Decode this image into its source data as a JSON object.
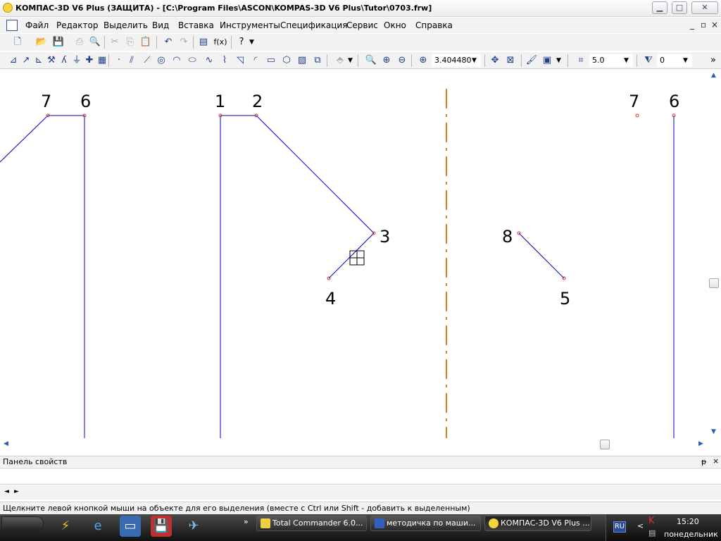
{
  "window": {
    "title": "КОМПАС-3D V6 Plus (ЗАЩИТА) - [C:\\Program Files\\ASCON\\KOMPAS-3D V6 Plus\\Tutor\\0703.frw]",
    "min_icon": "minimize-icon",
    "max_icon": "maximize-icon",
    "close_icon": "close-icon"
  },
  "menubar": {
    "items": [
      "Файл",
      "Редактор",
      "Выделить",
      "Вид",
      "Вставка",
      "Инструменты",
      "Спецификация",
      "Сервис",
      "Окно",
      "Справка"
    ],
    "controls": [
      "_",
      "▫",
      "×"
    ]
  },
  "toolbar": {
    "zoom_value": "3.404480",
    "step_value": "5.0",
    "layer_value": "0",
    "fx_label": "f(x)",
    "help_label": "?"
  },
  "drawing": {
    "colors": {
      "line": "#0000c8",
      "point": "#e03030",
      "axis": "#e08010",
      "cursor": "#000000"
    },
    "point_labels": [
      "7",
      "6",
      "1",
      "2",
      "3",
      "4",
      "8",
      "5",
      "7",
      "6"
    ]
  },
  "properties_panel": {
    "title": "Панель свойств",
    "nav_prev": "◄",
    "nav_next": "►",
    "pin": "ᵽ",
    "close": "×"
  },
  "status": {
    "text": "Щелкните левой кнопкой мыши на объекте для его выделения (вместе с Ctrl или Shift - добавить к выделенным)"
  },
  "taskbar": {
    "expand": "»",
    "tasks": [
      {
        "label": "Total Commander 6.0...",
        "icon_color": "#f0d040"
      },
      {
        "label": "методичка по маши...",
        "icon_color": "#3060c0"
      },
      {
        "label": "КОМПАС-3D V6 Plus ...",
        "icon_color": "#f4d43a"
      }
    ],
    "lang": "RU",
    "tray_arrow": "<",
    "clock": "15:20",
    "day": "понедельник"
  }
}
